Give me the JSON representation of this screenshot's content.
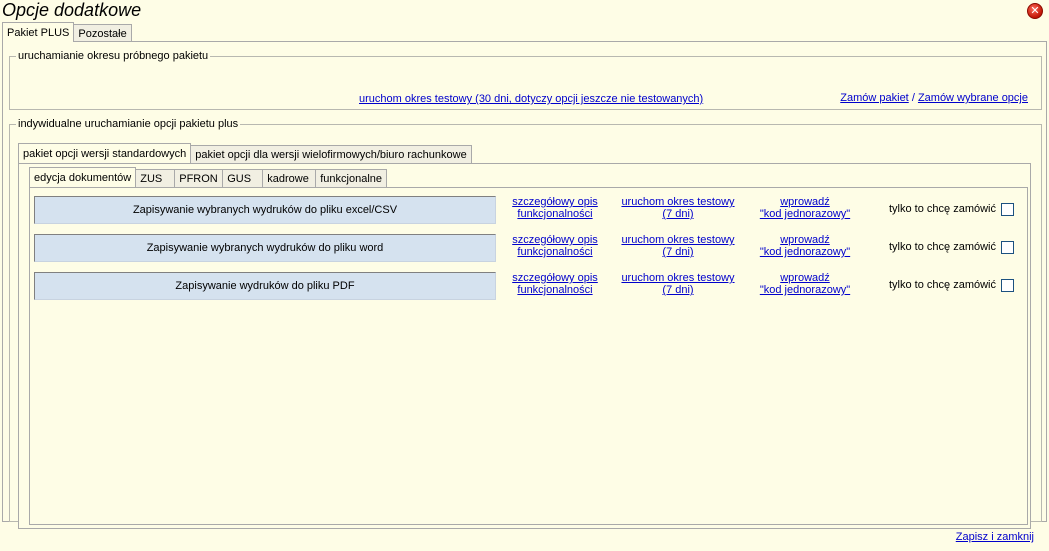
{
  "window": {
    "title": "Opcje dodatkowe"
  },
  "top_tabs": [
    "Pakiet PLUS",
    "Pozostałe"
  ],
  "trial_group": {
    "legend": "uruchamianie okresu próbnego pakietu",
    "trial_link": "uruchom okres testowy (30 dni, dotyczy opcji jeszcze nie testowanych)",
    "order_package": "Zamów pakiet",
    "separator": "/",
    "order_selected": "Zamów wybrane opcje"
  },
  "individual_group": {
    "legend": "indywidualne uruchamianie opcji pakietu plus",
    "sub_tabs": [
      "pakiet opcji wersji standardowych",
      "pakiet opcji dla wersji wielofirmowych/biuro rachunkowe"
    ],
    "category_tabs": [
      "edycja dokumentów",
      "ZUS",
      "PFRON",
      "GUS",
      "kadrowe",
      "funkcjonalne"
    ],
    "options": [
      {
        "name": "Zapisywanie wybranych wydruków do pliku excel/CSV",
        "desc_line1": "szczegółowy opis",
        "desc_line2": "funkcjonalności",
        "test_line1": "uruchom okres testowy",
        "test_line2": "(7 dni)",
        "code_line1": "wprowadź",
        "code_line2": "\"kod jednorazowy\"",
        "only_order": "tylko to chcę zamówić",
        "checked": false
      },
      {
        "name": "Zapisywanie wybranych wydruków do pliku word",
        "desc_line1": "szczegółowy opis",
        "desc_line2": "funkcjonalności",
        "test_line1": "uruchom okres testowy",
        "test_line2": "(7 dni)",
        "code_line1": "wprowadź",
        "code_line2": "\"kod jednorazowy\"",
        "only_order": "tylko to chcę zamówić",
        "checked": false
      },
      {
        "name": "Zapisywanie wydruków do pliku PDF",
        "desc_line1": "szczegółowy opis",
        "desc_line2": "funkcjonalności",
        "test_line1": "uruchom okres testowy",
        "test_line2": "(7 dni)",
        "code_line1": "wprowadź",
        "code_line2": "\"kod jednorazowy\"",
        "only_order": "tylko to chcę zamówić",
        "checked": false
      }
    ]
  },
  "footer": {
    "save_close": "Zapisz i zamknij"
  },
  "icons": {
    "close": "close-icon"
  },
  "colors": {
    "background": "#fefde6",
    "option_bar": "#d5e2ef",
    "link": "#0000cc",
    "close_red": "#c01505"
  }
}
